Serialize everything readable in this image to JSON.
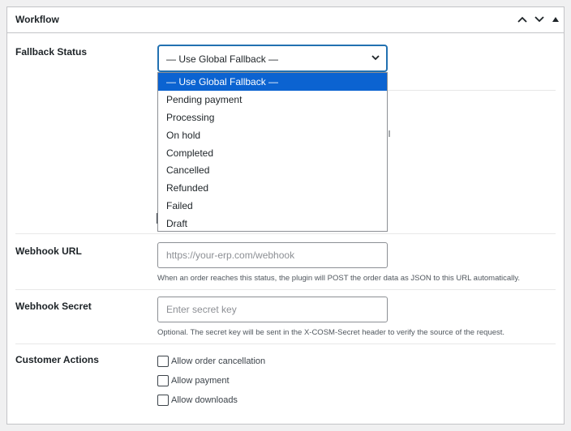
{
  "panel": {
    "title": "Workflow",
    "controls": [
      "chevron-up-icon",
      "chevron-down-icon",
      "triangle-up-icon"
    ]
  },
  "fallback_status": {
    "label": "Fallback Status",
    "selected": "— Use Global Fallback —",
    "options": [
      "— Use Global Fallback —",
      "Pending payment",
      "Processing",
      "On hold",
      "Completed",
      "Cancelled",
      "Refunded",
      "Failed",
      "Draft"
    ]
  },
  "webhook_url": {
    "label": "Webhook URL",
    "value": "",
    "placeholder": "https://your-erp.com/webhook",
    "help": "When an order reaches this status, the plugin will POST the order data as JSON to this URL automatically."
  },
  "webhook_secret": {
    "label": "Webhook Secret",
    "value": "",
    "placeholder": "Enter secret key",
    "help": "Optional. The secret key will be sent in the X-COSM-Secret header to verify the source of the request."
  },
  "customer_actions": {
    "label": "Customer Actions",
    "options": [
      {
        "label": "Allow order cancellation",
        "checked": false
      },
      {
        "label": "Allow payment",
        "checked": false
      },
      {
        "label": "Allow downloads",
        "checked": false
      }
    ]
  },
  "colors": {
    "accent": "#2271b1",
    "selected_option": "#0b63d1",
    "border": "#c3c4c7",
    "background": "#f0f0f1"
  }
}
